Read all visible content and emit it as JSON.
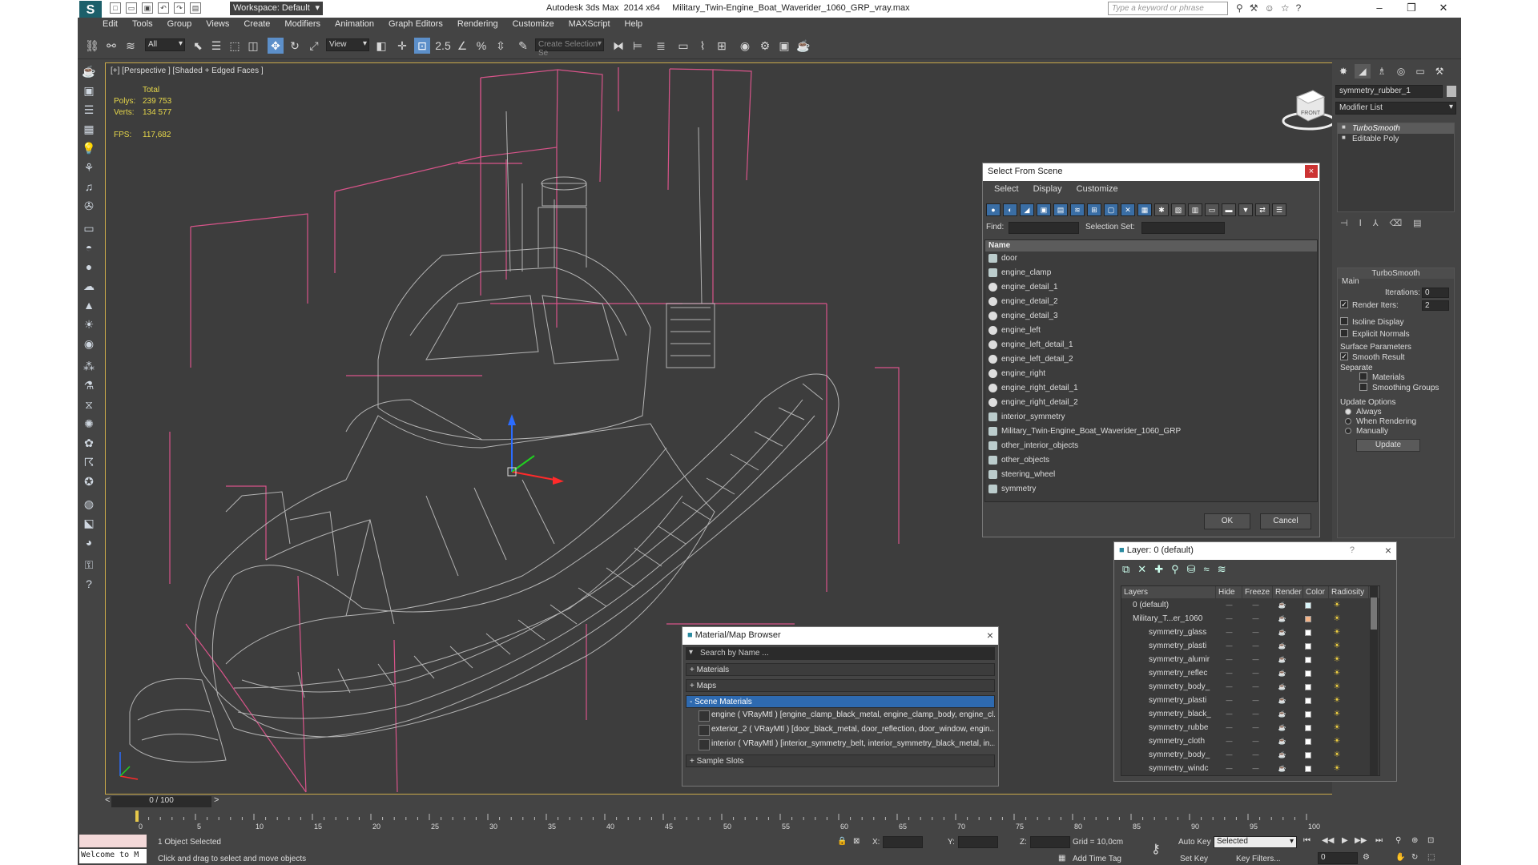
{
  "title": {
    "workspace": "Workspace: Default",
    "window_title": "Autodesk 3ds Max  2014 x64     Military_Twin-Engine_Boat_Waverider_1060_GRP_vray.max",
    "search_placeholder": "Type a keyword or phrase"
  },
  "menu": [
    "Edit",
    "Tools",
    "Group",
    "Views",
    "Create",
    "Modifiers",
    "Animation",
    "Graph Editors",
    "Rendering",
    "Customize",
    "MAXScript",
    "Help"
  ],
  "toolbar": {
    "filter": "All",
    "ref_coord": "View",
    "named_selection": "Create Selection Se",
    "snap_label": "2.5"
  },
  "viewport": {
    "label": "[+] [Perspective ] [Shaded + Edged Faces ]",
    "stats_total": "Total",
    "polys_label": "Polys:",
    "polys_value": "239 753",
    "verts_label": "Verts:",
    "verts_value": "134 577",
    "fps_label": "FPS:",
    "fps_value": "117,682",
    "viewcube_label": "FRONT"
  },
  "command_panel": {
    "object_name": "symmetry_rubber_1",
    "modifier_list": "Modifier List",
    "stack": [
      "TurboSmooth",
      "Editable Poly"
    ],
    "rollout_title": "TurboSmooth",
    "main": "Main",
    "iterations_label": "Iterations:",
    "iterations_value": "0",
    "render_iters_label": "Render Iters:",
    "render_iters_value": "2",
    "isoline": "Isoline Display",
    "explicit_normals": "Explicit Normals",
    "surface_params": "Surface Parameters",
    "smooth_result": "Smooth Result",
    "separate": "Separate",
    "materials": "Materials",
    "smoothing_groups": "Smoothing Groups",
    "update_options": "Update Options",
    "always": "Always",
    "when_rendering": "When Rendering",
    "manually": "Manually",
    "update_btn": "Update"
  },
  "select_from_scene": {
    "title": "Select From Scene",
    "menu": [
      "Select",
      "Display",
      "Customize"
    ],
    "find_label": "Find:",
    "selection_set_label": "Selection Set:",
    "column_name": "Name",
    "items": [
      {
        "name": "door",
        "icon": "group"
      },
      {
        "name": "engine_clamp",
        "icon": "group"
      },
      {
        "name": "engine_detail_1",
        "icon": "sphere"
      },
      {
        "name": "engine_detail_2",
        "icon": "sphere"
      },
      {
        "name": "engine_detail_3",
        "icon": "sphere"
      },
      {
        "name": "engine_left",
        "icon": "sphere"
      },
      {
        "name": "engine_left_detail_1",
        "icon": "sphere"
      },
      {
        "name": "engine_left_detail_2",
        "icon": "sphere"
      },
      {
        "name": "engine_right",
        "icon": "sphere"
      },
      {
        "name": "engine_right_detail_1",
        "icon": "sphere"
      },
      {
        "name": "engine_right_detail_2",
        "icon": "sphere"
      },
      {
        "name": "interior_symmetry",
        "icon": "group"
      },
      {
        "name": "Military_Twin-Engine_Boat_Waverider_1060_GRP",
        "icon": "group"
      },
      {
        "name": "other_interior_objects",
        "icon": "group"
      },
      {
        "name": "other_objects",
        "icon": "group"
      },
      {
        "name": "steering_wheel",
        "icon": "group"
      },
      {
        "name": "symmetry",
        "icon": "group"
      }
    ],
    "ok": "OK",
    "cancel": "Cancel"
  },
  "material_browser": {
    "title": "Material/Map Browser",
    "search": "Search by Name ...",
    "sections": [
      "+ Materials",
      "+ Maps",
      "- Scene Materials"
    ],
    "scene_materials": [
      "engine  ( VRayMtl ) [engine_clamp_black_metal, engine_clamp_body, engine_cl...",
      "exterior_2  ( VRayMtl ) [door_black_metal, door_reflection, door_window, engin...",
      "interior  ( VRayMtl ) [interior_symmetry_belt, interior_symmetry_black_metal, in..."
    ],
    "sample_slots": "+ Sample Slots"
  },
  "layer_dialog": {
    "title": "Layer: 0 (default)",
    "help": "?",
    "columns": [
      "Layers",
      "Hide",
      "Freeze",
      "Render",
      "Color",
      "Radiosity"
    ],
    "rows": [
      {
        "name": "0 (default)",
        "level": 0,
        "color": "#d8f4f8"
      },
      {
        "name": "Military_T...er_1060",
        "level": 0,
        "color": "#f4b488"
      },
      {
        "name": "symmetry_glass",
        "level": 1,
        "color": "#ffffff"
      },
      {
        "name": "symmetry_plasti",
        "level": 1,
        "color": "#ffffff"
      },
      {
        "name": "symmetry_alumir",
        "level": 1,
        "color": "#ffffff"
      },
      {
        "name": "symmetry_reflec",
        "level": 1,
        "color": "#ffffff"
      },
      {
        "name": "symmetry_body_",
        "level": 1,
        "color": "#ffffff"
      },
      {
        "name": "symmetry_plasti",
        "level": 1,
        "color": "#ffffff"
      },
      {
        "name": "symmetry_black_",
        "level": 1,
        "color": "#ffffff"
      },
      {
        "name": "symmetry_rubbe",
        "level": 1,
        "color": "#ffffff"
      },
      {
        "name": "symmetry_cloth",
        "level": 1,
        "color": "#ffffff"
      },
      {
        "name": "symmetry_body_",
        "level": 1,
        "color": "#ffffff"
      },
      {
        "name": "symmetry_windc",
        "level": 1,
        "color": "#ffffff"
      }
    ]
  },
  "timeline": {
    "frame": "0 / 100",
    "ticks": [
      "0",
      "5",
      "10",
      "15",
      "20",
      "25",
      "30",
      "35",
      "40",
      "45",
      "50",
      "55",
      "60",
      "65",
      "70",
      "75",
      "80",
      "85",
      "90",
      "95",
      "100"
    ]
  },
  "status": {
    "listener": "Welcome to M",
    "selected": "1 Object Selected",
    "prompt": "Click and drag to select and move objects",
    "x_label": "X:",
    "y_label": "Y:",
    "z_label": "Z:",
    "grid": "Grid = 10,0cm",
    "add_time_tag": "Add Time Tag",
    "auto_key": "Auto Key",
    "set_key": "Set Key",
    "selected_mode": "Selected",
    "key_filters": "Key Filters...",
    "frame_value": "0"
  },
  "colors": {
    "helper_pink": "#d8548a",
    "wire": "#c8c8c8",
    "stats": "#e6d74a",
    "accent": "#5c8fc9"
  }
}
